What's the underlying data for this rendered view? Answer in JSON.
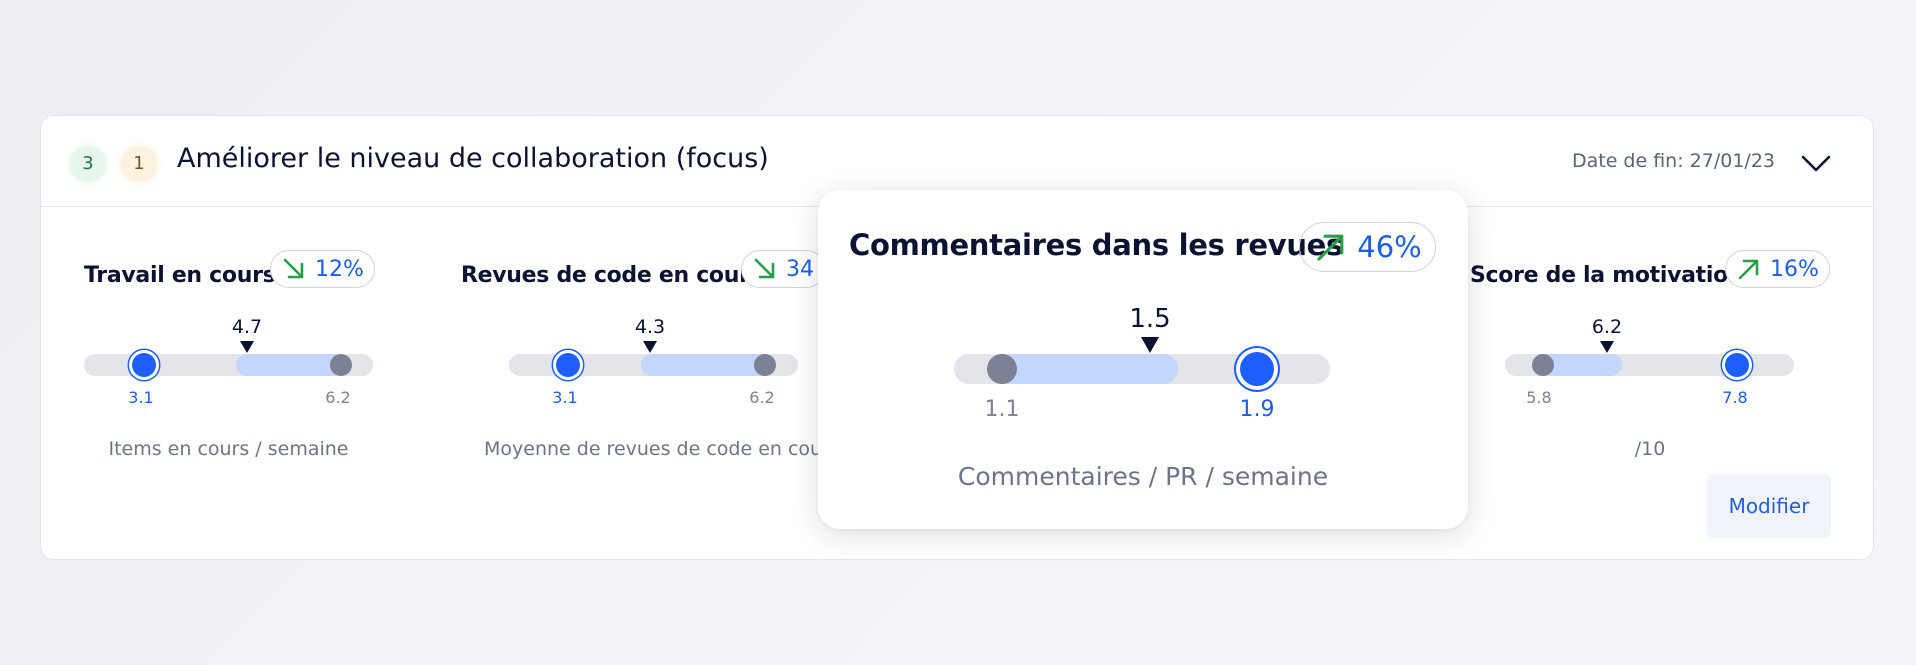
{
  "header": {
    "badge_green": "3",
    "badge_yellow": "1",
    "title": "Améliorer le niveau de collaboration (focus)",
    "end_date": "Date de fin: 27/01/23",
    "chevron_icon": "chevron-down-icon"
  },
  "metrics": [
    {
      "title": "Travail en cours",
      "trend": {
        "direction": "down",
        "icon": "arrow-down-right-icon",
        "color": "#2a9d4a",
        "pct": "12%"
      },
      "current": "4.7",
      "left_value": "3.1",
      "right_value": "6.2",
      "unit": "Items en cours / semaine"
    },
    {
      "title": "Revues de code en cours",
      "trend": {
        "direction": "down",
        "icon": "arrow-down-right-icon",
        "color": "#2a9d4a",
        "pct": "34"
      },
      "current": "4.3",
      "left_value": "3.1",
      "right_value": "6.2",
      "unit": "Moyenne de revues de code en cours"
    },
    {
      "title": "Score de la motivation",
      "trend": {
        "direction": "up",
        "icon": "arrow-up-right-icon",
        "color": "#2a9d4a",
        "pct": "16%"
      },
      "current": "6.2",
      "left_value": "5.8",
      "right_value": "7.8",
      "unit": "/10"
    }
  ],
  "popup": {
    "title": "Commentaires dans les revues",
    "trend": {
      "direction": "up",
      "icon": "arrow-up-right-icon",
      "color": "#2a9d4a",
      "pct": "46%"
    },
    "current": "1.5",
    "left_value": "1.1",
    "right_value": "1.9",
    "unit": "Commentaires / PR / semaine"
  },
  "actions": {
    "modify_label": "Modifier"
  },
  "colors": {
    "accent": "#1e5fff",
    "range_fill": "#c3d6fb",
    "track": "#e4e5ea",
    "trend_arrow": "#2a9d4a"
  }
}
